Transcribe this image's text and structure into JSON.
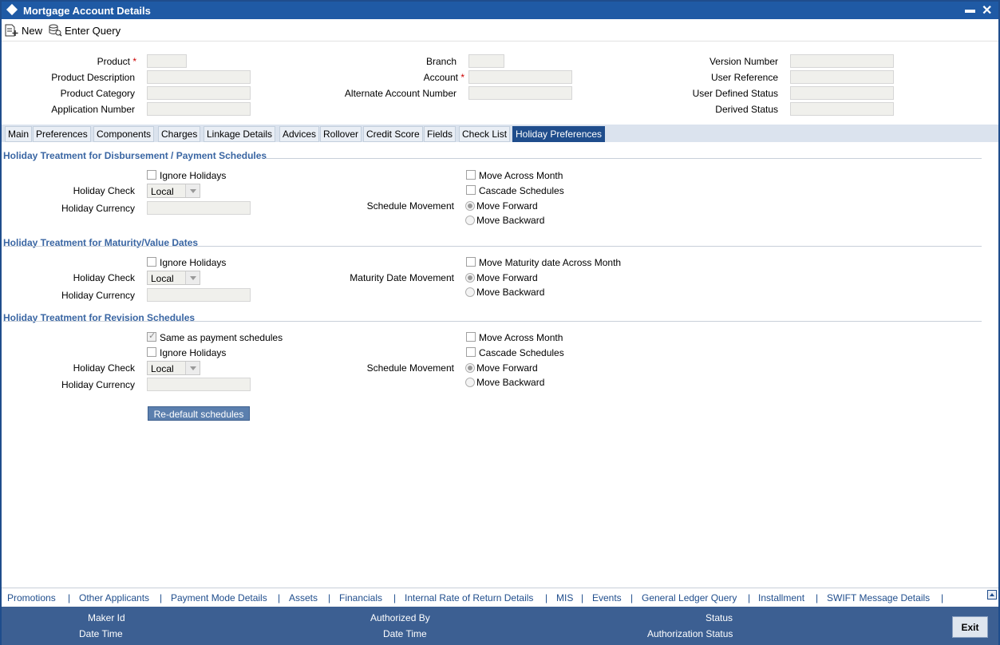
{
  "window": {
    "title": "Mortgage Account Details",
    "minimize": "▬",
    "close": "✕"
  },
  "toolbar": {
    "new_label": "New",
    "enter_query_label": "Enter Query"
  },
  "header": {
    "product_label": "Product",
    "product_description_label": "Product Description",
    "product_category_label": "Product Category",
    "application_number_label": "Application Number",
    "branch_label": "Branch",
    "account_label": "Account",
    "alternate_account_label": "Alternate Account Number",
    "version_number_label": "Version Number",
    "user_reference_label": "User Reference",
    "user_defined_status_label": "User Defined Status",
    "derived_status_label": "Derived Status",
    "required_mark": "*"
  },
  "tabs": [
    {
      "label": "Main"
    },
    {
      "label": "Preferences"
    },
    {
      "label": "Components"
    },
    {
      "label": "Charges"
    },
    {
      "label": "Linkage Details"
    },
    {
      "label": "Advices"
    },
    {
      "label": "Rollover"
    },
    {
      "label": "Credit Score"
    },
    {
      "label": "Fields"
    },
    {
      "label": "Check List"
    },
    {
      "label": "Holiday Preferences"
    }
  ],
  "disbursement": {
    "title": "Holiday Treatment for Disbursement / Payment Schedules",
    "ignore_holidays": "Ignore Holidays",
    "holiday_check_label": "Holiday Check",
    "holiday_check_value": "Local",
    "holiday_currency_label": "Holiday Currency",
    "move_across_month": "Move Across Month",
    "cascade_schedules": "Cascade Schedules",
    "schedule_movement_label": "Schedule Movement",
    "move_forward": "Move Forward",
    "move_backward": "Move Backward"
  },
  "maturity": {
    "title": "Holiday Treatment for Maturity/Value Dates",
    "ignore_holidays": "Ignore Holidays",
    "holiday_check_label": "Holiday Check",
    "holiday_check_value": "Local",
    "holiday_currency_label": "Holiday Currency",
    "move_maturity_across_month": "Move Maturity date Across Month",
    "maturity_date_movement_label": "Maturity Date Movement",
    "move_forward": "Move Forward",
    "move_backward": "Move Backward"
  },
  "revision": {
    "title": "Holiday Treatment for Revision Schedules",
    "same_as_payment": "Same as payment schedules",
    "ignore_holidays": "Ignore Holidays",
    "holiday_check_label": "Holiday Check",
    "holiday_check_value": "Local",
    "holiday_currency_label": "Holiday Currency",
    "move_across_month": "Move Across Month",
    "cascade_schedules": "Cascade Schedules",
    "schedule_movement_label": "Schedule Movement",
    "move_forward": "Move Forward",
    "move_backward": "Move Backward",
    "redefault_button": "Re-default schedules"
  },
  "footer_links": [
    {
      "label": "Promotions"
    },
    {
      "label": "Other Applicants"
    },
    {
      "label": "Payment Mode Details"
    },
    {
      "label": "Assets"
    },
    {
      "label": "Financials"
    },
    {
      "label": "Internal Rate of Return Details"
    },
    {
      "label": "MIS"
    },
    {
      "label": "Events"
    },
    {
      "label": "General Ledger Query"
    },
    {
      "label": "Installment"
    },
    {
      "label": "SWIFT Message Details"
    }
  ],
  "separator": "|",
  "status_bar": {
    "maker_id": "Maker Id",
    "date_time_1": "Date Time",
    "authorized_by": "Authorized By",
    "date_time_2": "Date Time",
    "status": "Status",
    "authorization_status": "Authorization Status",
    "exit_button": "Exit"
  }
}
